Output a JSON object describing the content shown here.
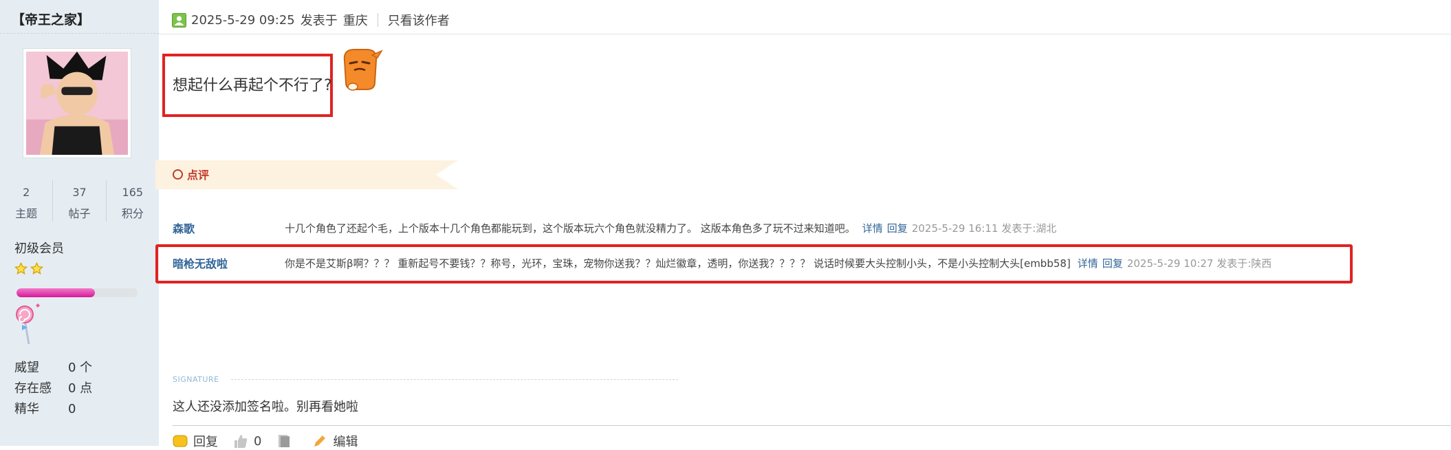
{
  "author": {
    "username": "【帝王之家】",
    "stats": [
      {
        "value": "2",
        "label": "主题"
      },
      {
        "value": "37",
        "label": "帖子"
      },
      {
        "value": "165",
        "label": "积分"
      }
    ],
    "group": "初级会员",
    "star_count": 2,
    "level_progress": 0.65,
    "info": [
      {
        "key": "威望",
        "value": "0 个"
      },
      {
        "key": "存在感",
        "value": "0 点"
      },
      {
        "key": "精华",
        "value": "0"
      }
    ]
  },
  "post": {
    "datetime": "2025-5-29 09:25",
    "posted_at_label": "发表于",
    "location": "重庆",
    "only_author_label": "只看该作者",
    "content": "想起什么再起个不行了?",
    "emoji_icon": "orange-cartoon-emoji"
  },
  "review": {
    "title": "点评",
    "comments": [
      {
        "author": "森歌",
        "text": "十几个角色了还起个毛，上个版本十几个角色都能玩到，这个版本玩六个角色就没精力了。 这版本角色多了玩不过来知道吧。",
        "detail_label": "详情",
        "reply_label": "回复",
        "time": "2025-5-29 16:11 发表于:湖北"
      },
      {
        "author": "暗枪无敌啦",
        "text": "你是不是艾斯β啊？？？ 重新起号不要钱？？称号，光环，宝珠，宠物你送我？？灿烂徽章，透明，你送我？？？？ 说话时候要大头控制小头，不是小头控制大头[embb58]",
        "detail_label": "详情",
        "reply_label": "回复",
        "time": "2025-5-29 10:27 发表于:陕西"
      }
    ]
  },
  "signature": {
    "label": "SIGNATURE",
    "text": "这人还没添加签名啦。别再看她啦"
  },
  "footer": {
    "reply_label": "回复",
    "like_count": "0",
    "edit_label": "编辑"
  },
  "colors": {
    "sidebar_bg": "#e5edf2",
    "highlight_red": "#e02222",
    "link_blue": "#336699"
  }
}
